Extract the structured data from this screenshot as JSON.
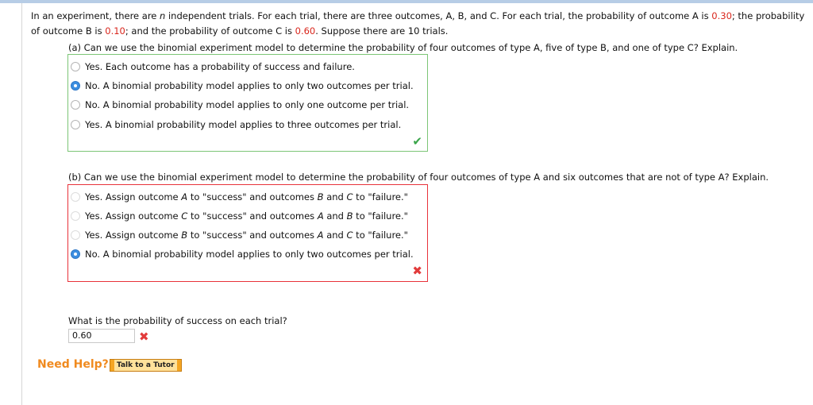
{
  "intro": {
    "p1": "In an experiment, there are ",
    "n": "n",
    "p2": " independent trials. For each trial, there are three outcomes, A, B, and C. For each trial, the probability of outcome A is ",
    "pa": "0.30",
    "p3": "; the probability of outcome B is ",
    "pb": "0.10",
    "p4": "; and the probability of outcome C is ",
    "pc": "0.60",
    "p5": ". Suppose there are 10 trials."
  },
  "part_a": {
    "question": "(a) Can we use the binomial experiment model to determine the probability of four outcomes of type A, five of type B, and one of type C? Explain.",
    "options": [
      "Yes. Each outcome has a probability of success and failure.",
      "No. A binomial probability model applies to only two outcomes per trial.",
      "No. A binomial probability model applies to only one outcome per trial.",
      "Yes. A binomial probability model applies to three outcomes per trial."
    ],
    "selected": 1
  },
  "part_b": {
    "question": "(b) Can we use the binomial experiment model to determine the probability of four outcomes of type A and six outcomes that are not of type A? Explain.",
    "options": [
      {
        "a": "Yes. Assign outcome ",
        "v1": "A",
        "b": " to \"success\" and outcomes ",
        "v2": "B",
        "c": " and ",
        "v3": "C",
        "d": " to \"failure.\""
      },
      {
        "a": "Yes. Assign outcome ",
        "v1": "C",
        "b": " to \"success\" and outcomes ",
        "v2": "A",
        "c": " and ",
        "v3": "B",
        "d": " to \"failure.\""
      },
      {
        "a": "Yes. Assign outcome ",
        "v1": "B",
        "b": " to \"success\" and outcomes ",
        "v2": "A",
        "c": " and ",
        "v3": "C",
        "d": " to \"failure.\""
      },
      {
        "a": "No. A binomial probability model applies to only two outcomes per trial.",
        "v1": "",
        "b": "",
        "v2": "",
        "c": "",
        "v3": "",
        "d": ""
      }
    ],
    "selected": 3
  },
  "part_c": {
    "question": "What is the probability of success on each trial?",
    "value": "0.60"
  },
  "help": {
    "label": "Need Help?",
    "tutor_button": "Talk to a Tutor"
  },
  "colors": {
    "correct": "#3aa54a",
    "incorrect": "#e23b3b",
    "red_value": "#d9261c",
    "radio_selected": "#3d8ee0"
  },
  "icons": {
    "correct": "checkmark-icon",
    "incorrect": "cross-icon"
  }
}
